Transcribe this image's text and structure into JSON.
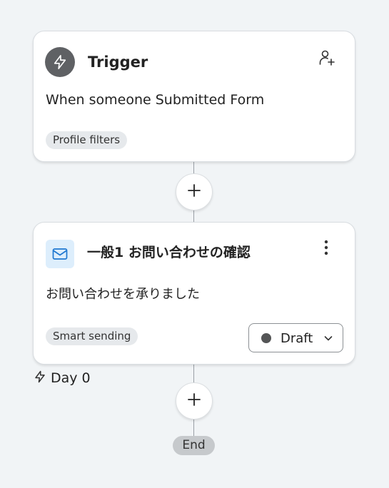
{
  "trigger": {
    "icon": "lightning-bolt-icon",
    "title": "Trigger",
    "add_user_icon": "add-user-icon",
    "description": "When someone Submitted Form",
    "filter_pill": "Profile filters"
  },
  "add_step_icon": "plus-icon",
  "email_step": {
    "icon": "envelope-icon",
    "title": "一般1 お問い合わせの確認",
    "menu_icon": "vertical-ellipsis-icon",
    "subject": "お問い合わせを承りました",
    "smart_sending_pill": "Smart sending",
    "status": {
      "label": "Draft",
      "dot_color": "#545556",
      "chevron_icon": "chevron-down-icon"
    },
    "accent_color": "#ddeefc"
  },
  "delay": {
    "icon": "lightning-bolt-icon",
    "label": "Day 0"
  },
  "end_label": "End",
  "colors": {
    "background": "#f1f4f6",
    "trigger_icon_bg": "#5f6164",
    "email_icon_stroke": "#1f78d1",
    "pill_bg": "#e6e9ec",
    "end_pill_bg": "#c6c9cc"
  }
}
